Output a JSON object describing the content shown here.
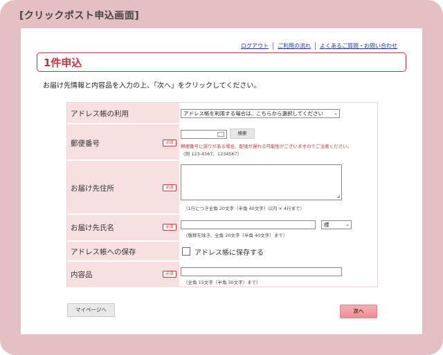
{
  "window_title": "[クリックポスト申込画面]",
  "top_links": [
    {
      "label": "ログアウト"
    },
    {
      "label": "ご利用の流れ"
    },
    {
      "label": "よくあるご質問・お問い合わせ"
    }
  ],
  "page_heading": "1件申込",
  "instruction": "お届け先情報と内容品を入力の上、「次へ」をクリックしてください。",
  "required_badge": "必須",
  "form": {
    "address_book": {
      "label": "アドレス帳の利用",
      "select_value": "アドレス帳を利用する場合は、こちらから選択してください"
    },
    "postal_code": {
      "label": "郵便番号",
      "value": "",
      "search_button": "検索",
      "warning": "郵便番号に誤りがある場合、配達が遅れる可能性がございますのでご注意ください。",
      "example": "（例 123-4567、1234567）"
    },
    "address": {
      "label": "お届け先住所",
      "value": "",
      "hint": "（1行につき全角 20文字（半角 40文字）以内 × 4行まで）"
    },
    "name": {
      "label": "お届け先氏名",
      "value": "",
      "honorific_selected": "様",
      "hint": "（敬称を除き、全角 20文字（半角 40文字）まで）"
    },
    "save_address": {
      "label": "アドレス帳への保存",
      "checkbox_label": "アドレス帳に保存する",
      "checked": false
    },
    "contents": {
      "label": "内容品",
      "value": "",
      "hint": "（全角 15文字（半角 30文字）まで）"
    }
  },
  "buttons": {
    "mypage": "マイページへ",
    "next": "次へ"
  },
  "colors": {
    "accent": "#c8323d",
    "frame_bg": "#e4bfc4",
    "label_bg": "#f8dfe2",
    "next_button": "#ef8c93"
  }
}
